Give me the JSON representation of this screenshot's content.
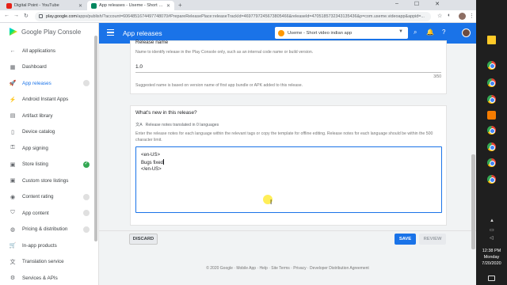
{
  "browser": {
    "tabs": [
      {
        "title": "Digital Point - YouTube"
      },
      {
        "title": "App releases - Useme - Short vid..."
      }
    ],
    "new_tab": "+",
    "window_controls": [
      "–",
      "☐",
      "✕"
    ],
    "url_host": "play.google.com",
    "url_path": "/apps/publish/?account=6064851674497748070#PrepareReleasePlace:releaseTrackId=4697797245673805466&releaseId=4705185732343135436&p=com.useme.videoapp&appid=..."
  },
  "sidebar": {
    "logo_text": "Google Play Console",
    "items": [
      {
        "label": "All applications",
        "icon": "arrow-left-icon",
        "glyph": "←",
        "status": ""
      },
      {
        "label": "Dashboard",
        "icon": "dashboard-icon",
        "glyph": "▦",
        "status": ""
      },
      {
        "label": "App releases",
        "icon": "rocket-icon",
        "glyph": "🚀",
        "status": "pending",
        "active": true
      },
      {
        "label": "Android Instant Apps",
        "icon": "instant-icon",
        "glyph": "⚡",
        "status": ""
      },
      {
        "label": "Artifact library",
        "icon": "library-icon",
        "glyph": "▤",
        "status": ""
      },
      {
        "label": "Device catalog",
        "icon": "device-icon",
        "glyph": "▯",
        "status": ""
      },
      {
        "label": "App signing",
        "icon": "key-icon",
        "glyph": "⚿",
        "status": ""
      },
      {
        "label": "Store listing",
        "icon": "store-icon",
        "glyph": "▣",
        "status": "ok"
      },
      {
        "label": "Custom store listings",
        "icon": "custom-store-icon",
        "glyph": "▣",
        "status": ""
      },
      {
        "label": "Content rating",
        "icon": "rating-icon",
        "glyph": "◉",
        "status": "pending"
      },
      {
        "label": "App content",
        "icon": "shield-icon",
        "glyph": "⛉",
        "status": "pending"
      },
      {
        "label": "Pricing & distribution",
        "icon": "globe-icon",
        "glyph": "◍",
        "status": "pending"
      },
      {
        "label": "In-app products",
        "icon": "cart-icon",
        "glyph": "🛒",
        "status": ""
      },
      {
        "label": "Translation service",
        "icon": "translate-icon",
        "glyph": "文",
        "status": ""
      },
      {
        "label": "Services & APIs",
        "icon": "api-icon",
        "glyph": "⚙",
        "status": ""
      }
    ]
  },
  "header": {
    "title": "App releases",
    "app_name": "Useme - Short video indian app"
  },
  "release_name": {
    "heading": "Release name",
    "description": "Name to identify release in the Play Console only, such as an internal code name or build version.",
    "value": "1.0",
    "counter": "3/50",
    "hint": "Suggested name is based on version name of first app bundle or APK added to this release."
  },
  "whats_new": {
    "heading": "What's new in this release?",
    "translated": "Release notes translated in 0 languages",
    "description": "Enter the release notes for each language within the relevant tags or copy the template for offline editing. Release notes for each language should be within the 500 character limit.",
    "lines": [
      "<en-US>",
      "Bugs fixed",
      "</en-US>"
    ]
  },
  "actions": {
    "discard": "DISCARD",
    "save": "SAVE",
    "review": "REVIEW"
  },
  "footer": "© 2020 Google · Mobile App · Help · Site Terms · Privacy · Developer Distribution Agreement",
  "taskbar": {
    "time": "12:38 PM",
    "day": "Monday",
    "date": "7/20/2020"
  }
}
